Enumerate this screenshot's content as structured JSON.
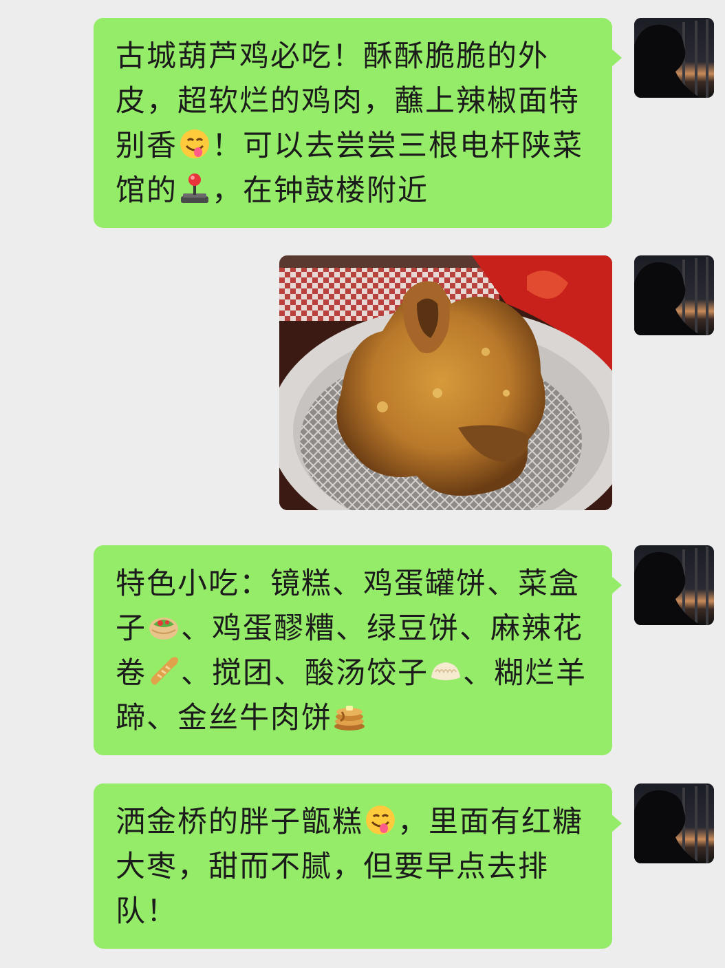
{
  "messages": [
    {
      "type": "text",
      "segments": [
        "古城葫芦鸡必吃！酥酥脆脆的外皮，超软烂的鸡肉，蘸上辣椒面特别香",
        "！可以去尝尝三根电杆陕菜馆的",
        "，在钟鼓楼附近"
      ],
      "emojis": [
        "face-savoring-food-emoji",
        "joystick-emoji"
      ]
    },
    {
      "type": "image",
      "description_icon": "fried-chicken-photo"
    },
    {
      "type": "text",
      "segments": [
        "特色小吃：镜糕、鸡蛋罐饼、菜盒子",
        "、鸡蛋醪糟、绿豆饼、麻辣花卷",
        "、搅团、酸汤饺子",
        "、糊烂羊蹄、金丝牛肉饼",
        ""
      ],
      "emojis": [
        "stuffed-flatbread-emoji",
        "baguette-emoji",
        "dumpling-emoji",
        "pancakes-emoji"
      ]
    },
    {
      "type": "text",
      "segments": [
        "洒金桥的胖子甑糕",
        "，里面有红糖大枣，甜而不腻，但要早点去排队！"
      ],
      "emojis": [
        "face-savoring-food-emoji"
      ]
    }
  ],
  "colors": {
    "background": "#ededed",
    "bubble": "#95ec69",
    "text": "#1b1b1b"
  }
}
